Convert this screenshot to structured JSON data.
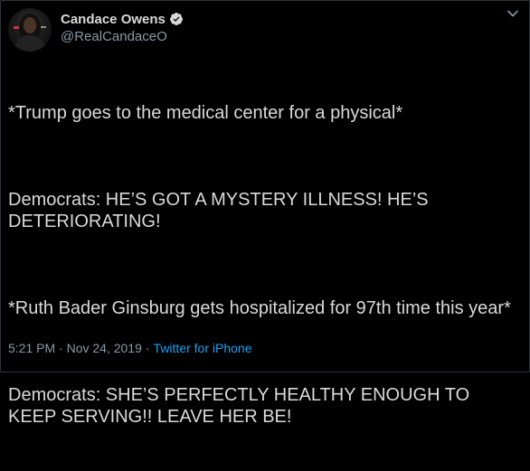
{
  "tweet": {
    "author": {
      "display_name": "Candace Owens",
      "handle": "@RealCandaceO",
      "verified": true,
      "avatar_icon": "profile-photo"
    },
    "paragraphs": [
      "*Trump goes to the medical center for a physical*",
      "Democrats: HE’S GOT A MYSTERY ILLNESS! HE’S DETERIORATING!",
      "*Ruth Bader Ginsburg gets hospitalized for 97th time this year*",
      "Democrats: SHE’S PERFECTLY HEALTHY ENOUGH TO KEEP SERVING!! LEAVE HER BE!"
    ],
    "timestamp": "5:21 PM · Nov 24, 2019",
    "separator": "·",
    "source": "Twitter for iPhone"
  },
  "icons": {
    "verified": "verified-badge-icon",
    "menu": "chevron-down-icon"
  },
  "colors": {
    "background": "#000000",
    "text": "#d9d9d9",
    "muted": "#8899a6",
    "link": "#1da1f2",
    "border": "#2f3336"
  }
}
